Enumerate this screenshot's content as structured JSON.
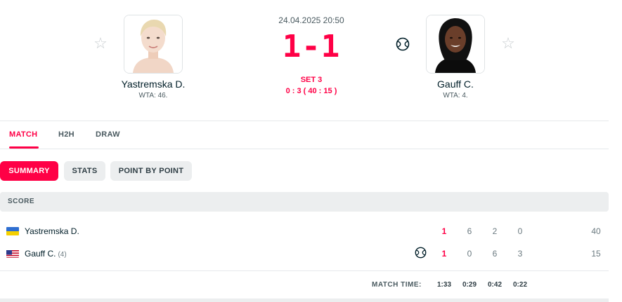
{
  "match": {
    "datetime": "24.04.2025 20:50",
    "score": "1-1",
    "set_label": "SET 3",
    "game_score": "0 : 3 ( 40 : 15 )"
  },
  "home": {
    "name": "Yastremska D.",
    "rank": "WTA: 46.",
    "row_name": "Yastremska D.",
    "seed": "",
    "sets_won": "1",
    "sets": [
      "6",
      "2",
      "0"
    ],
    "points": "40",
    "flag": "ukraine-flag"
  },
  "away": {
    "name": "Gauff C.",
    "rank": "WTA: 4.",
    "row_name": "Gauff C.",
    "seed": "(4)",
    "sets_won": "1",
    "sets": [
      "0",
      "6",
      "3"
    ],
    "points": "15",
    "flag": "usa-flag",
    "serving": true
  },
  "tabs": [
    "MATCH",
    "H2H",
    "DRAW"
  ],
  "subtabs": [
    "SUMMARY",
    "STATS",
    "POINT BY POINT"
  ],
  "section": {
    "title": "SCORE"
  },
  "match_time": {
    "label": "MATCH TIME:",
    "values": [
      "1:33",
      "0:29",
      "0:42",
      "0:22"
    ]
  },
  "colors": {
    "accent": "#ff0046",
    "text": "#001e28",
    "muted": "#4a5a60",
    "panel": "#eceeef"
  },
  "icons": {
    "favorite": "star-outline-icon",
    "serve": "tennis-ball-icon"
  }
}
